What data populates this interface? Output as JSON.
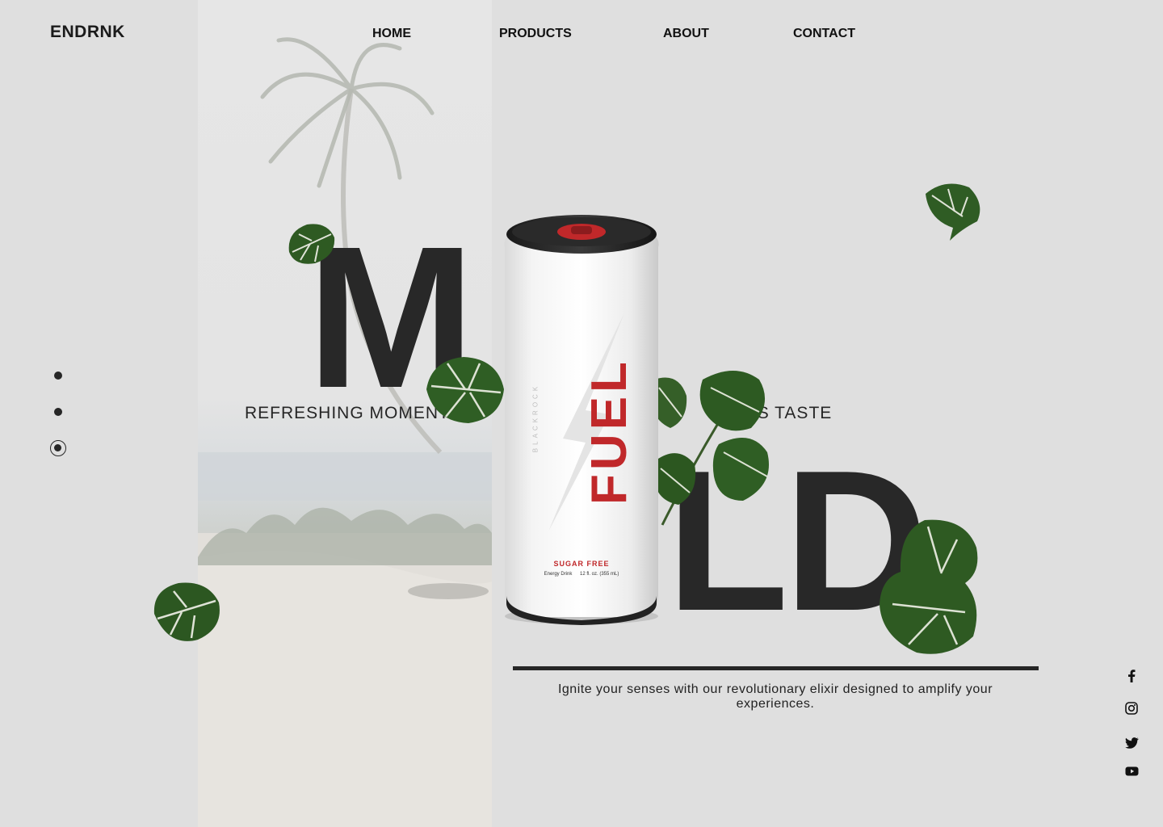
{
  "brand": {
    "logo": "ENDRNK"
  },
  "nav": {
    "items": [
      {
        "label": "HOME"
      },
      {
        "label": "PRODUCTS"
      },
      {
        "label": "ABOUT"
      },
      {
        "label": "CONTACT"
      }
    ]
  },
  "hero": {
    "letter_left": "M",
    "letter_right": "LD",
    "tagline_left": "REFRESHING MOMENTS",
    "tagline_right": "LESS TASTE",
    "description": "Ignite your senses with our revolutionary elixir designed to amplify your experiences."
  },
  "product": {
    "brand_name": "FUEL",
    "sub_brand": "BLACKROCK",
    "badge": "SUGAR FREE",
    "type": "Energy Drink",
    "volume": "12 fl. oz. (355 mL)"
  },
  "slider": {
    "dot_count": 3,
    "active_index": 2
  },
  "social": {
    "icons": [
      "facebook-icon",
      "instagram-icon",
      "twitter-icon",
      "youtube-icon"
    ]
  },
  "colors": {
    "background": "#dfdfdf",
    "text": "#262626",
    "accent_red": "#c0282a",
    "leaf_green": "#2e5a22"
  }
}
